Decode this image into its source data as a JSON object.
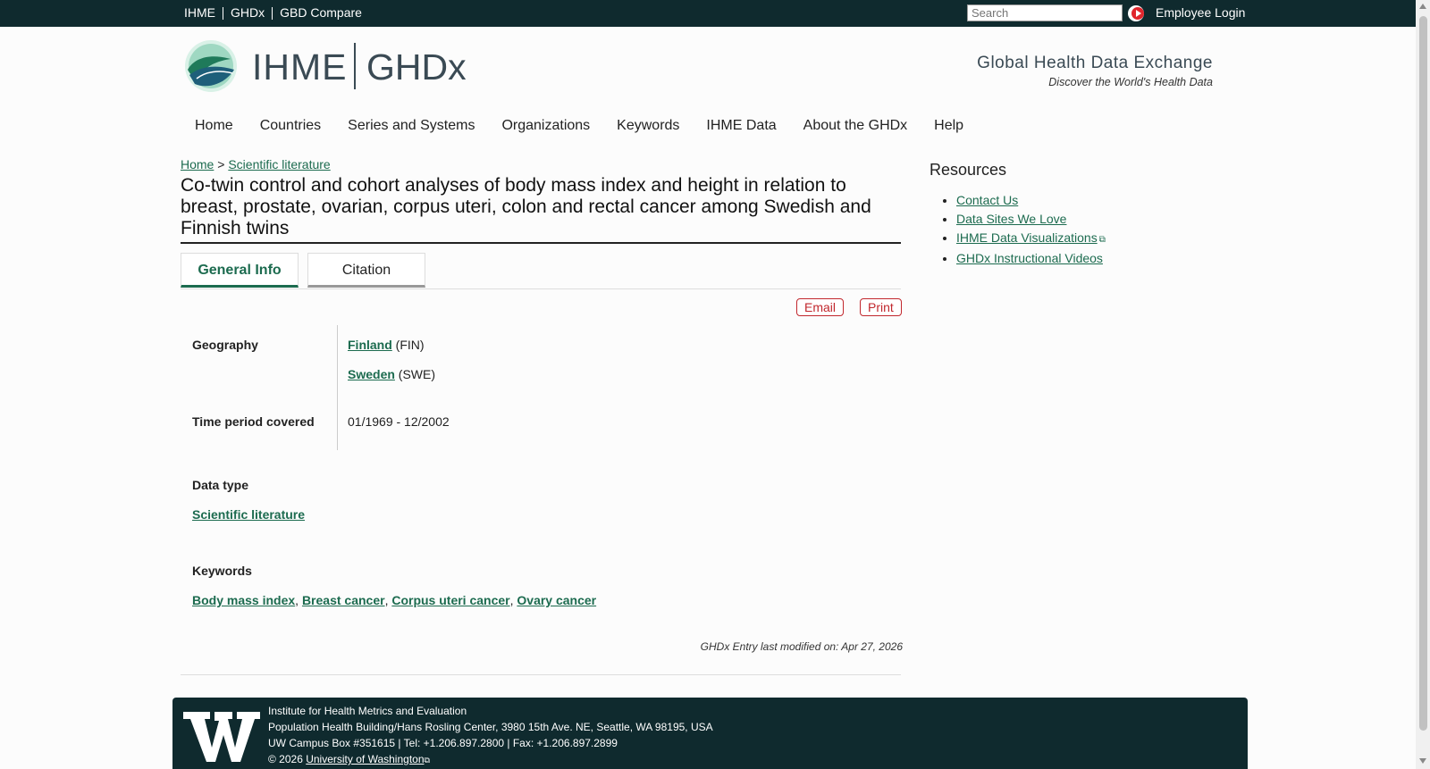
{
  "topbar": {
    "links": [
      "IHME",
      "GHDx",
      "GBD Compare"
    ],
    "search_placeholder": "Search",
    "employee_login": "Employee Login"
  },
  "header": {
    "logo_ihme": "IHME",
    "logo_ghdx": "GHDx",
    "tagline_title": "Global Health Data Exchange",
    "tagline_sub": "Discover the World's Health Data"
  },
  "nav": [
    "Home",
    "Countries",
    "Series and Systems",
    "Organizations",
    "Keywords",
    "IHME Data",
    "About the GHDx",
    "Help"
  ],
  "breadcrumb": {
    "home": "Home",
    "sep": ">",
    "current": "Scientific literature"
  },
  "record": {
    "title": "Co-twin control and cohort analyses of body mass index and height in relation to breast, prostate, ovarian, corpus uteri, colon and rectal cancer among Swedish and Finnish twins",
    "tabs": [
      "General Info",
      "Citation"
    ],
    "email": "Email",
    "print": "Print",
    "geography_label": "Geography",
    "geography": [
      {
        "name": "Finland",
        "code": "(FIN)"
      },
      {
        "name": "Sweden",
        "code": "(SWE)"
      }
    ],
    "time_label": "Time period covered",
    "time_value": "01/1969 - 12/2002",
    "data_type_label": "Data type",
    "data_type_value": "Scientific literature",
    "keywords_label": "Keywords",
    "keywords": [
      "Body mass index",
      "Breast cancer",
      "Corpus uteri cancer",
      "Ovary cancer"
    ],
    "modified": "GHDx Entry last modified on: Apr 27, 2026"
  },
  "sidebar": {
    "title": "Resources",
    "links": [
      "Contact Us",
      "Data Sites We Love",
      "IHME Data Visualizations",
      "GHDx Instructional Videos"
    ]
  },
  "footer": {
    "line1": "Institute for Health Metrics and Evaluation",
    "line2": "Population Health Building/Hans Rosling Center, 3980 15th Ave. NE, Seattle, WA 98195, USA",
    "line3": "UW Campus Box #351615 | Tel: +1.206.897.2800 | Fax: +1.206.897.2899",
    "copyright": "© 2026",
    "uw_link": "University of Washington"
  },
  "colors": {
    "topbar": "#0f2a2e",
    "link": "#1c6b4f",
    "accent_red": "#c1272d"
  }
}
